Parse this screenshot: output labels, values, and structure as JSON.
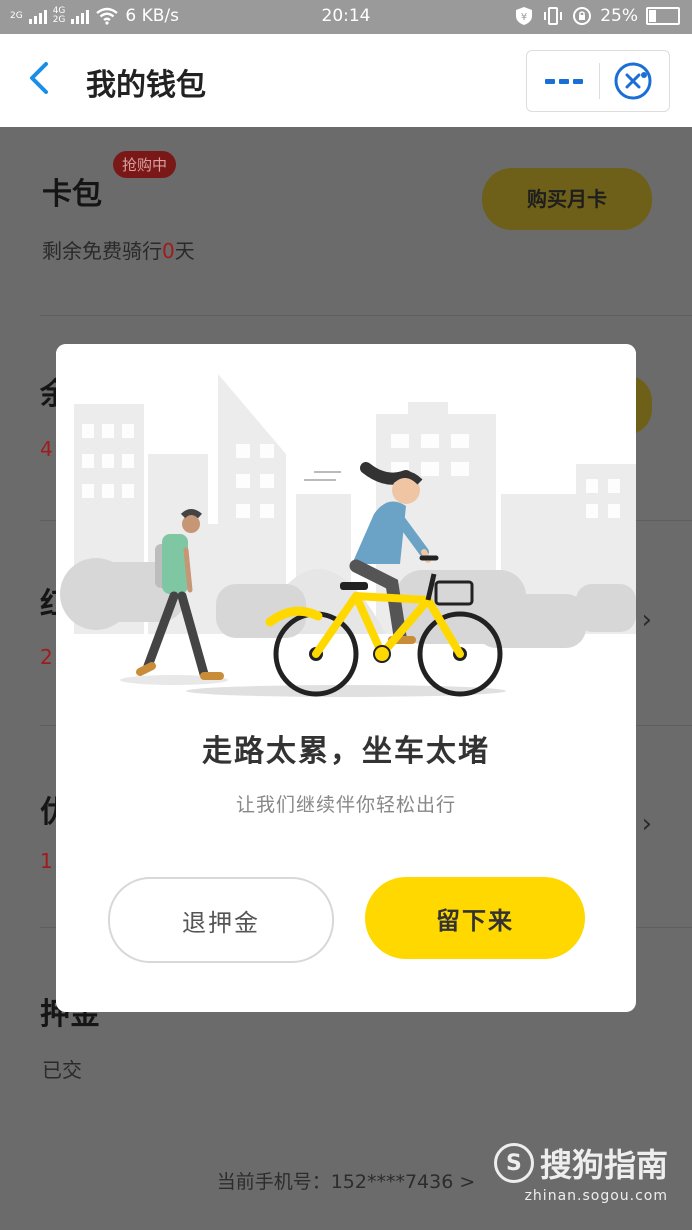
{
  "status_bar": {
    "network": "2G 4G 2G",
    "speed": "6 KB/s",
    "time": "20:14",
    "battery": "25%"
  },
  "header": {
    "back_icon": "chevron-left-icon",
    "title": "我的钱包",
    "more_icon": "more-dots-icon",
    "close_icon": "close-circle-icon"
  },
  "card_pack": {
    "title": "卡包",
    "badge": "抢购中",
    "subtitle_prefix": "剩余免费骑行",
    "free_days": "0",
    "subtitle_suffix": "天",
    "buy_button": "购买月卡"
  },
  "hidden_rows": [
    {
      "title_char": "余",
      "sub_char": "4"
    },
    {
      "title_char": "红",
      "sub_char": "2"
    },
    {
      "title_char": "优",
      "sub_char": "1"
    }
  ],
  "deposit": {
    "title": "押金",
    "status": "已交"
  },
  "footer": {
    "phone_label": "当前手机号：152****7436 >"
  },
  "modal": {
    "title": "走路太累，坐车太堵",
    "subtitle": "让我们继续伴你轻松出行",
    "refund_button": "退押金",
    "stay_button": "留下来"
  },
  "watermark": {
    "brand": "搜狗指南",
    "url": "zhinan.sogou.com"
  },
  "colors": {
    "accent_yellow": "#ffd800",
    "back_blue": "#1a8ee6",
    "overlay": "#6b6b6b"
  }
}
